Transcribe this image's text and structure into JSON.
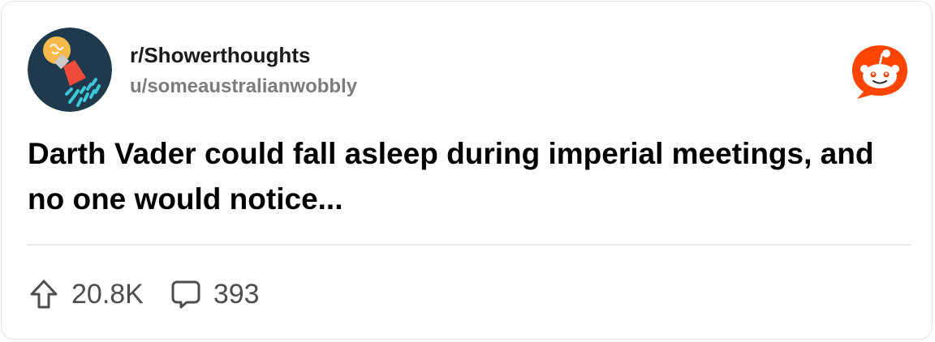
{
  "post": {
    "subreddit": "r/Showerthoughts",
    "author": "u/someaustralianwobbly",
    "title": "Darth Vader could fall asleep during imperial meetings, and no one would notice...",
    "upvotes": "20.8K",
    "comments": "393"
  },
  "icons": {
    "avatar": "showerhead-lightbulb-icon",
    "brand": "reddit-logo-icon",
    "upvote": "upvote-arrow-icon",
    "comment": "comment-bubble-icon"
  },
  "colors": {
    "brand": "#ff4500",
    "avatar_bg": "#1e3a4c",
    "bulb": "#f7b94a",
    "shower": "#ef4b3c",
    "water": "#3cc6d6",
    "text_primary": "#000000",
    "text_secondary": "#7c7c7c",
    "stat_text": "#4d4d4d"
  }
}
